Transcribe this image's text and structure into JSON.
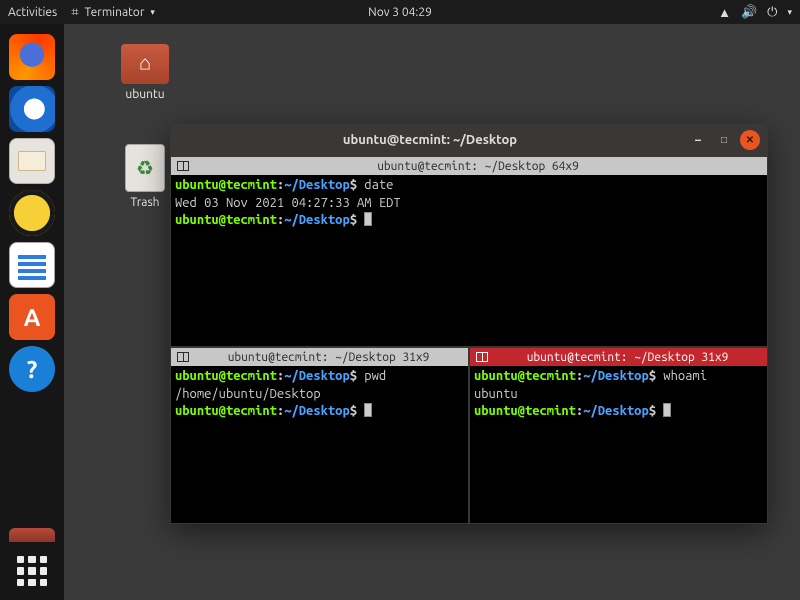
{
  "topbar": {
    "activities": "Activities",
    "app_name": "Terminator",
    "clock": "Nov 3  04:29"
  },
  "system_tray": {
    "network_icon": "network-icon",
    "volume_icon": "volume-icon",
    "power_icon": "power-icon"
  },
  "desktop": {
    "home_label": "ubuntu",
    "trash_label": "Trash"
  },
  "dock": {
    "items": [
      "firefox",
      "thunderbird",
      "files",
      "rhythmbox",
      "writer",
      "software",
      "help"
    ]
  },
  "window": {
    "title": "ubuntu@tecmint: ~/Desktop"
  },
  "panes": {
    "top": {
      "tab": "ubuntu@tecmint: ~/Desktop 64x9",
      "prompt_user": "ubuntu@tecmint",
      "prompt_path": "~/Desktop",
      "cmd1": "date",
      "out1": "Wed 03 Nov 2021 04:27:33 AM EDT"
    },
    "left": {
      "tab": "ubuntu@tecmint: ~/Desktop 31x9",
      "prompt_user": "ubuntu@tecmint",
      "prompt_path": "~/Desktop",
      "cmd1": "pwd",
      "out1": "/home/ubuntu/Desktop"
    },
    "right": {
      "tab": "ubuntu@tecmint: ~/Desktop 31x9",
      "prompt_user": "ubuntu@tecmint",
      "prompt_path": "~/Desktop",
      "cmd1": "whoami",
      "out1": "ubuntu"
    }
  }
}
